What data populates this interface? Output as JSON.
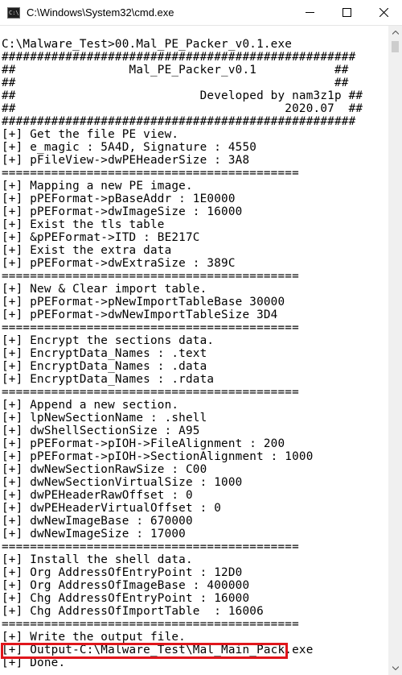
{
  "window": {
    "title": "C:\\Windows\\System32\\cmd.exe",
    "icon_label": "C:\\",
    "icons": {
      "minimize": "minimize-icon",
      "maximize": "maximize-icon",
      "close": "close-icon"
    }
  },
  "console": {
    "lines": [
      "C:\\Malware_Test>00.Mal_PE_Packer_v0.1.exe",
      "##################################################",
      "##                Mal_PE_Packer_v0.1           ##",
      "##                                             ##",
      "##                          Developed by nam3z1p ##",
      "##                                      2020.07  ##",
      "##################################################",
      "[+] Get the file PE view.",
      "[+] e_magic : 5A4D, Signature : 4550",
      "[+] pFileView->dwPEHeaderSize : 3A8",
      "==========================================",
      "[+] Mapping a new PE image.",
      "[+] pPEFormat->pBaseAddr : 1E0000",
      "[+] pPEFormat->dwImageSize : 16000",
      "[+] Exist the tls table",
      "[+] &pPEFormat->ITD : BE217C",
      "[+] Exist the extra data",
      "[+] pPEFormat->dwExtraSize : 389C",
      "==========================================",
      "[+] New & Clear import table.",
      "[+] pPEFormat->pNewImportTableBase 30000",
      "[+] pPEFormat->dwNewImportTableSize 3D4",
      "==========================================",
      "[+] Encrypt the sections data.",
      "[+] EncryptData_Names : .text",
      "[+] EncryptData_Names : .data",
      "[+] EncryptData_Names : .rdata",
      "==========================================",
      "[+] Append a new section.",
      "[+] lpNewSectionName : .shell",
      "[+] dwShellSectionSize : A95",
      "[+] pPEFormat->pIOH->FileAlignment : 200",
      "[+] pPEFormat->pIOH->SectionAlignment : 1000",
      "[+] dwNewSectionRawSize : C00",
      "[+] dwNewSectionVirtualSize : 1000",
      "[+] dwPEHeaderRawOffset : 0",
      "[+] dwPEHeaderVirtualOffset : 0",
      "[+] dwNewImageBase : 670000",
      "[+] dwNewImageSize : 17000",
      "==========================================",
      "[+] Install the shell data.",
      "[+] Org AddressOfEntryPoint : 12D0",
      "[+] Org AddressOfImageBase : 400000",
      "[+] Chg AddressOfEntryPoint : 16000",
      "[+] Chg AddressOfImportTable  : 16006",
      "==========================================",
      "[+] Write the output file.",
      "[+] Output-C:\\Malware_Test\\Mal_Main_Pack.exe",
      "[+] Done."
    ]
  },
  "colors": {
    "highlight_border": "#e0161c",
    "text": "#000000",
    "background": "#ffffff"
  }
}
